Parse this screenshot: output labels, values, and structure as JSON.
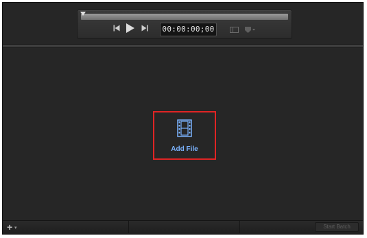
{
  "player": {
    "timecode": "00:00:00;00",
    "icons": [
      "skip-back-icon",
      "play-icon",
      "skip-forward-icon",
      "view-options-icon",
      "marker-icon"
    ]
  },
  "main": {
    "add_file_label": "Add File",
    "add_file_icon": "film-strip-icon"
  },
  "bottom_bar": {
    "add_label": "+",
    "add_menu_icon": "chevron-down-icon",
    "start_batch_label": "Start Batch"
  },
  "colors": {
    "accent": "#7bb3ff",
    "highlight": "#e02424",
    "background": "#262626"
  }
}
